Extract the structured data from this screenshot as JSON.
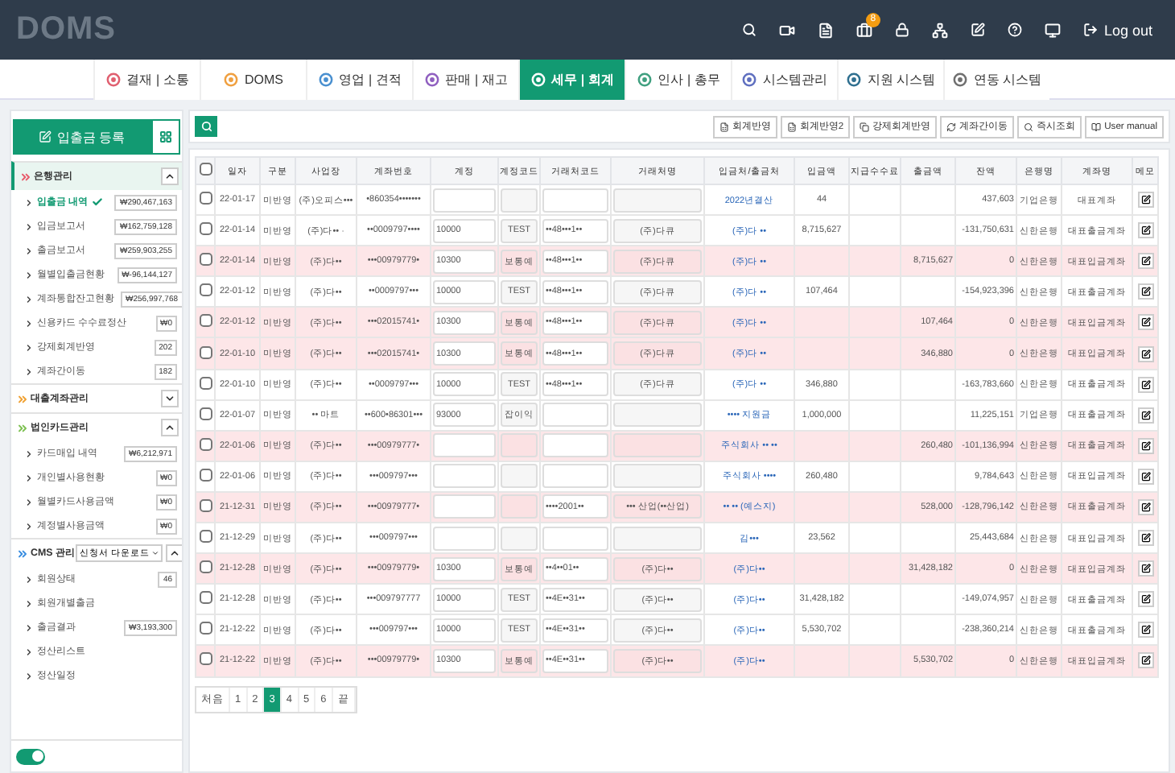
{
  "app": {
    "logo": "DOMS",
    "logout": "Log out",
    "notification_badge": "8"
  },
  "nav_tabs": [
    {
      "label": "결재 | 소통",
      "color": "#e06070",
      "selected": false
    },
    {
      "label": "DOMS",
      "color": "#f0a040",
      "selected": false
    },
    {
      "label": "영업 | 견적",
      "color": "#4a90d0",
      "selected": false
    },
    {
      "label": "판매 | 재고",
      "color": "#9060c0",
      "selected": false
    },
    {
      "label": "세무 | 회계",
      "color": "#ffffff",
      "selected": true
    },
    {
      "label": "인사 | 총무",
      "color": "#40a080",
      "selected": false
    },
    {
      "label": "시스템관리",
      "color": "#6070c0",
      "selected": false
    },
    {
      "label": "지원 시스템",
      "color": "#307090",
      "selected": false
    },
    {
      "label": "연동 시스템",
      "color": "#707070",
      "selected": false
    }
  ],
  "sidebar": {
    "register_button": "입출금 등록",
    "toggle_on": true,
    "sections": [
      {
        "title": "은행관리",
        "color": "#e85a6a",
        "expanded": true,
        "items": [
          {
            "label": "입출금 내역",
            "badge": "₩290,467,163",
            "selected": true
          },
          {
            "label": "입금보고서",
            "badge": "₩162,759,128",
            "selected": false
          },
          {
            "label": "출금보고서",
            "badge": "₩259,903,255",
            "selected": false
          },
          {
            "label": "월별입출금현황",
            "badge": "₩-96,144,127",
            "selected": false
          },
          {
            "label": "계좌통합잔고현황",
            "badge": "₩256,997,768",
            "selected": false
          },
          {
            "label": "신용카드 수수료정산",
            "badge": "₩0",
            "selected": false
          },
          {
            "label": "강제회계반영",
            "badge": "202",
            "selected": false
          },
          {
            "label": "계좌간이동",
            "badge": "182",
            "selected": false
          }
        ]
      },
      {
        "title": "대출계좌관리",
        "color": "#f0a030",
        "expanded": false
      },
      {
        "title": "법인카드관리",
        "color": "#7cc050",
        "expanded": true,
        "items": [
          {
            "label": "카드매입 내역",
            "badge": "₩6,212,971",
            "selected": false
          },
          {
            "label": "개인별사용현황",
            "badge": "₩0",
            "selected": false
          },
          {
            "label": "월별카드사용금액",
            "badge": "₩0",
            "selected": false
          },
          {
            "label": "계정별사용금액",
            "badge": "₩0",
            "selected": false
          }
        ]
      },
      {
        "title": "CMS 관리",
        "color": "#3a8ee0",
        "expanded": true,
        "dropdown": "신청서 다운로드",
        "items": [
          {
            "label": "회원상태",
            "badge": "46",
            "selected": false
          },
          {
            "label": "회원개별출금",
            "selected": false
          },
          {
            "label": "출금결과",
            "badge": "₩3,193,300",
            "selected": false
          },
          {
            "label": "정산리스트",
            "selected": false
          },
          {
            "label": "정산일정",
            "selected": false
          }
        ]
      }
    ]
  },
  "toolbar": [
    "회계반영",
    "회계반영2",
    "강제회계반영",
    "계좌간이동",
    "즉시조회",
    "User manual"
  ],
  "table": {
    "all_checked": false,
    "columns": [
      "일자",
      "구분",
      "사업장",
      "계좌번호",
      "계정",
      "계정코드",
      "거래처코드",
      "거래처명",
      "입금처/출금처",
      "입금액",
      "지급수수료",
      "출금액",
      "잔액",
      "은행명",
      "계좌명",
      "메모"
    ],
    "rows": [
      {
        "highlighted": false,
        "checked": false,
        "date": "22-01-17",
        "type": "미반영",
        "site": "(주)오피스•••",
        "account_no": "•860354•••••••",
        "counterparty": "2022년결산",
        "deposit": "44",
        "balance": "437,603",
        "bank": "기업은행",
        "account_name": "대표계좌"
      },
      {
        "highlighted": false,
        "checked": false,
        "date": "22-01-14",
        "type": "미반영",
        "site": "(주)다•• ·",
        "account_no": "••0009797••••",
        "account": "10000",
        "account_code": "TEST",
        "partner_code": "••48•••1••",
        "partner_name": "(주)다큐",
        "counterparty": "(주)다 ••",
        "deposit": "8,715,627",
        "balance": "-131,750,631",
        "bank": "신한은행",
        "account_name": "대표출금계좌"
      },
      {
        "highlighted": true,
        "checked": false,
        "date": "22-01-14",
        "type": "미반영",
        "site": "(주)다••",
        "account_no": "•••00979779•",
        "account": "10300",
        "account_code": "보통예",
        "partner_code": "••48•••1••",
        "partner_name": "(주)다큐",
        "counterparty": "(주)다 ••",
        "withdrawal": "8,715,627",
        "balance": "0",
        "bank": "신한은행",
        "account_name": "대표입금계좌"
      },
      {
        "highlighted": false,
        "checked": false,
        "date": "22-01-12",
        "type": "미반영",
        "site": "(주)다••",
        "account_no": "••0009797•••",
        "account": "10000",
        "account_code": "TEST",
        "partner_code": "••48•••1••",
        "partner_name": "(주)다큐",
        "counterparty": "(주)다 ••",
        "deposit": "107,464",
        "balance": "-154,923,396",
        "bank": "신한은행",
        "account_name": "대표출금계좌"
      },
      {
        "highlighted": true,
        "checked": false,
        "date": "22-01-12",
        "type": "미반영",
        "site": "(주)다••",
        "account_no": "•••02015741•",
        "account": "10300",
        "account_code": "보통예",
        "partner_code": "••48•••1••",
        "partner_name": "(주)다큐",
        "counterparty": "(주)다 ••",
        "withdrawal": "107,464",
        "balance": "0",
        "bank": "신한은행",
        "account_name": "대표입금계좌"
      },
      {
        "highlighted": true,
        "checked": false,
        "date": "22-01-10",
        "type": "미반영",
        "site": "(주)다••",
        "account_no": "•••02015741•",
        "account": "10300",
        "account_code": "보통예",
        "partner_code": "••48•••1••",
        "partner_name": "(주)다큐",
        "counterparty": "(주)다 ••",
        "withdrawal": "346,880",
        "balance": "0",
        "bank": "신한은행",
        "account_name": "대표입금계좌"
      },
      {
        "highlighted": false,
        "checked": false,
        "date": "22-01-10",
        "type": "미반영",
        "site": "(주)다••",
        "account_no": "••0009797•••",
        "account": "10000",
        "account_code": "TEST",
        "partner_code": "••48•••1••",
        "partner_name": "(주)다큐",
        "counterparty": "(주)다 ••",
        "deposit": "346,880",
        "balance": "-163,783,660",
        "bank": "신한은행",
        "account_name": "대표출금계좌"
      },
      {
        "highlighted": false,
        "checked": false,
        "date": "22-01-07",
        "type": "미반영",
        "site": "•• 마트",
        "account_no": "••600•86301•••",
        "account": "93000",
        "account_code": "잡이익",
        "counterparty": "•••• 지원금",
        "deposit": "1,000,000",
        "balance": "11,225,151",
        "bank": "기업은행",
        "account_name": "대표출금계좌"
      },
      {
        "highlighted": true,
        "checked": false,
        "date": "22-01-06",
        "type": "미반영",
        "site": "(주)다••",
        "account_no": "•••00979777•",
        "counterparty": "주식회사 •• ••",
        "withdrawal": "260,480",
        "balance": "-101,136,994",
        "bank": "신한은행",
        "account_name": "대표출금계좌"
      },
      {
        "highlighted": false,
        "checked": false,
        "date": "22-01-06",
        "type": "미반영",
        "site": "(주)다••",
        "account_no": "•••009797•••",
        "counterparty": "주식회사 ••••",
        "deposit": "260,480",
        "balance": "9,784,643",
        "bank": "신한은행",
        "account_name": "대표입금계좌"
      },
      {
        "highlighted": true,
        "checked": false,
        "date": "21-12-31",
        "type": "미반영",
        "site": "(주)다••",
        "account_no": "•••00979777•",
        "partner_code": "••••2001••",
        "partner_name": "••• 산업(••산업)",
        "counterparty": "•• •• (예스지)",
        "withdrawal": "528,000",
        "balance": "-128,796,142",
        "bank": "신한은행",
        "account_name": "대표출금계좌"
      },
      {
        "highlighted": false,
        "checked": false,
        "date": "21-12-29",
        "type": "미반영",
        "site": "(주)다••",
        "account_no": "•••009797•••",
        "counterparty": "김•••",
        "deposit": "23,562",
        "balance": "25,443,684",
        "bank": "신한은행",
        "account_name": "대표입금계좌"
      },
      {
        "highlighted": true,
        "checked": false,
        "date": "21-12-28",
        "type": "미반영",
        "site": "(주)다••",
        "account_no": "•••00979779•",
        "account": "10300",
        "account_code": "보통예",
        "partner_code": "••4••01••",
        "partner_name": "(주)다••",
        "counterparty": "(주)다••",
        "withdrawal": "31,428,182",
        "balance": "0",
        "bank": "신한은행",
        "account_name": "대표입금계좌"
      },
      {
        "highlighted": false,
        "checked": false,
        "date": "21-12-28",
        "type": "미반영",
        "site": "(주)다••",
        "account_no": "•••009797777",
        "account": "10000",
        "account_code": "TEST",
        "partner_code": "••4E••31••",
        "partner_name": "(주)다••",
        "counterparty": "(주)다••",
        "deposit": "31,428,182",
        "balance": "-149,074,957",
        "bank": "신한은행",
        "account_name": "대표출금계좌"
      },
      {
        "highlighted": false,
        "checked": false,
        "date": "21-12-22",
        "type": "미반영",
        "site": "(주)다••",
        "account_no": "•••009797•••",
        "account": "10000",
        "account_code": "TEST",
        "partner_code": "••4E••31••",
        "partner_name": "(주)다••",
        "counterparty": "(주)다••",
        "deposit": "5,530,702",
        "balance": "-238,360,214",
        "bank": "신한은행",
        "account_name": "대표출금계좌"
      },
      {
        "highlighted": true,
        "checked": false,
        "date": "21-12-22",
        "type": "미반영",
        "site": "(주)다••",
        "account_no": "•••00979779•",
        "account": "10300",
        "account_code": "보통예",
        "partner_code": "••4E••31••",
        "partner_name": "(주)다••",
        "counterparty": "(주)다••",
        "withdrawal": "5,530,702",
        "balance": "0",
        "bank": "신한은행",
        "account_name": "대표입금계좌"
      }
    ]
  },
  "pagination": [
    {
      "label": "처음",
      "selected": false
    },
    {
      "label": "1",
      "selected": false
    },
    {
      "label": "2",
      "selected": false
    },
    {
      "label": "3",
      "selected": true
    },
    {
      "label": "4",
      "selected": false
    },
    {
      "label": "5",
      "selected": false
    },
    {
      "label": "6",
      "selected": false
    },
    {
      "label": "끝",
      "selected": false
    }
  ]
}
